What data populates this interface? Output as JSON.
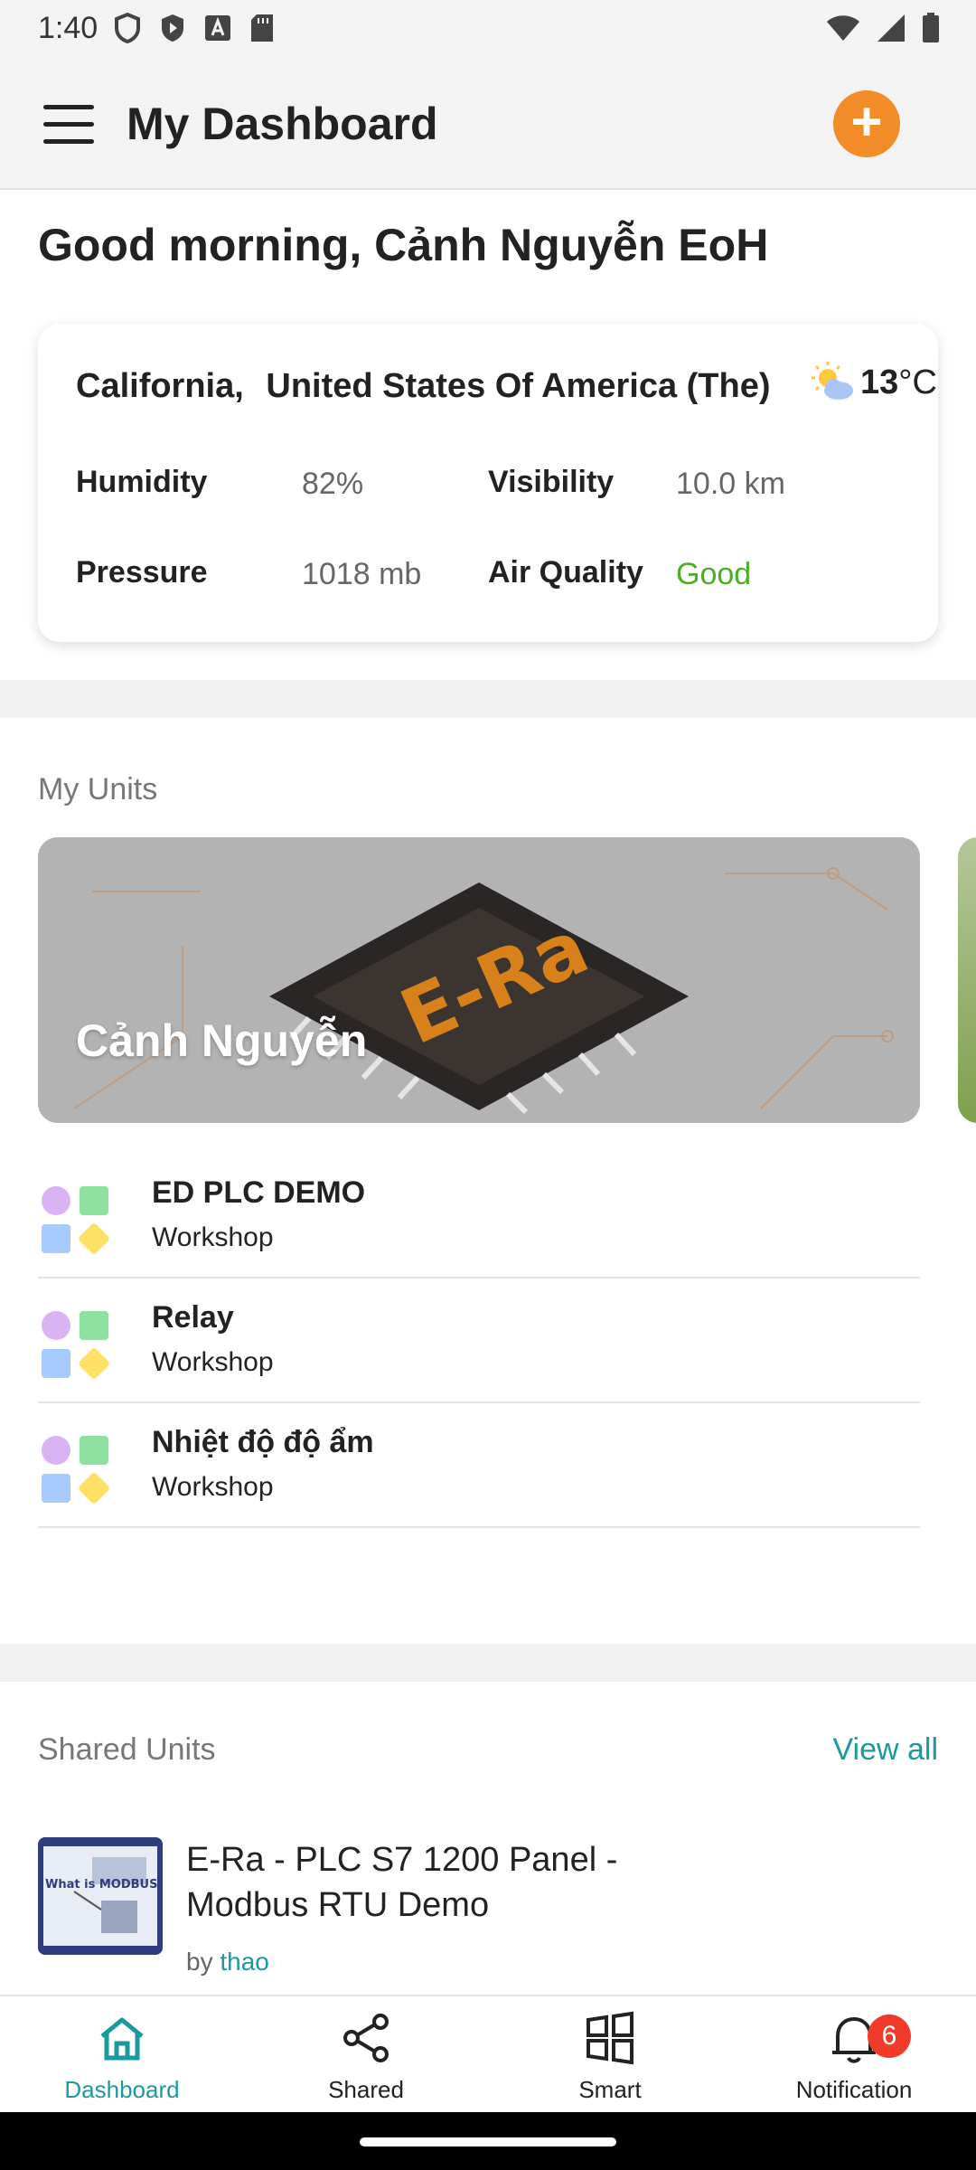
{
  "status_bar": {
    "time": "1:40"
  },
  "app_bar": {
    "title": "My Dashboard",
    "add_button": "+"
  },
  "greeting": "Good morning, Cảnh Nguyễn EoH",
  "weather": {
    "city": "California,",
    "country": "United States Of America (The)",
    "temperature": "13",
    "unit": "°C",
    "icon": "partly-sunny-icon",
    "humidity_label": "Humidity",
    "humidity_value": "82%",
    "visibility_label": "Visibility",
    "visibility_value": "10.0 km",
    "pressure_label": "Pressure",
    "pressure_value": "1018 mb",
    "air_quality_label": "Air Quality",
    "air_quality_value": "Good"
  },
  "my_units": {
    "label": "My Units",
    "banner_name": "Cảnh Nguyễn",
    "items": [
      {
        "name": "ED PLC DEMO",
        "type": "Workshop"
      },
      {
        "name": "Relay",
        "type": "Workshop"
      },
      {
        "name": "Nhiệt độ độ ẩm",
        "type": "Workshop"
      }
    ]
  },
  "shared_units": {
    "label": "Shared Units",
    "view_all": "View all",
    "item": {
      "title": "E-Ra - PLC S7 1200 Panel - Modbus RTU Demo",
      "by": "by",
      "author": "thao",
      "thumb_text": "What is MODBUS?"
    }
  },
  "bottom_nav": {
    "items": [
      {
        "label": "Dashboard",
        "icon": "home-icon"
      },
      {
        "label": "Shared",
        "icon": "share-icon"
      },
      {
        "label": "Smart",
        "icon": "grid-icon"
      },
      {
        "label": "Notification",
        "icon": "bell-icon"
      }
    ],
    "notification_count": "6"
  },
  "colors": {
    "accent": "#1a9aa0",
    "add_button": "#f28c28",
    "good": "#4caf23",
    "badge": "#f03a2a"
  }
}
